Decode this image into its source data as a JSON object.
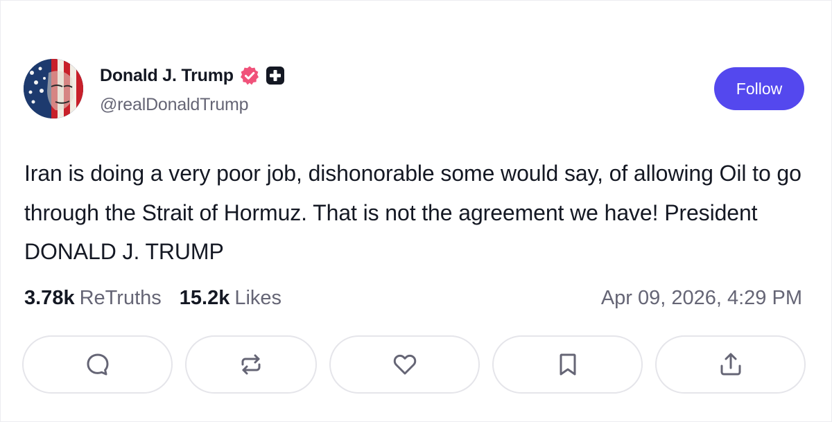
{
  "author": {
    "display_name": "Donald J. Trump",
    "handle": "@realDonaldTrump",
    "verified_icon": "verified-badge-icon",
    "platform_icon": "truth-social-plus-icon"
  },
  "header": {
    "follow_label": "Follow"
  },
  "post": {
    "text": "Iran is doing a very poor job, dishonorable some would say, of allowing Oil to go through the Strait of Hormuz. That is not the agreement we have! President DONALD J. TRUMP"
  },
  "stats": {
    "retruths_count": "3.78k",
    "retruths_label": "ReTruths",
    "likes_count": "15.2k",
    "likes_label": "Likes",
    "timestamp": "Apr 09, 2026, 4:29 PM"
  },
  "actions": [
    {
      "icon": "reply-icon"
    },
    {
      "icon": "retruth-icon"
    },
    {
      "icon": "like-heart-icon"
    },
    {
      "icon": "bookmark-icon"
    },
    {
      "icon": "share-icon"
    }
  ],
  "colors": {
    "accent": "#5448ee",
    "verified": "#f0527a",
    "muted_text": "#656575",
    "text": "#141823",
    "border": "#e5e5ea"
  }
}
